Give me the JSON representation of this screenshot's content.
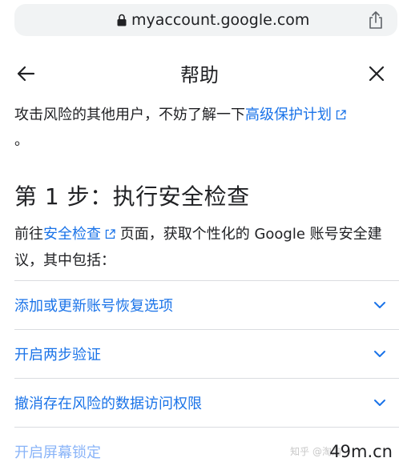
{
  "browser": {
    "url": "myaccount.google.com"
  },
  "header": {
    "title": "帮助"
  },
  "content": {
    "para1_text": "攻击风险的其他用户，不妨了解一下",
    "para1_link": "高级保护计划",
    "para1_end": "。",
    "heading": "第 1 步：执行安全检查",
    "para2_pre": "前往",
    "para2_link": "安全检查",
    "para2_post": "页面，获取个性化的 Google 账号安全建议，其中包括："
  },
  "list": {
    "items": [
      {
        "label": "添加或更新账号恢复选项"
      },
      {
        "label": "开启两步验证"
      },
      {
        "label": "撤消存在风险的数据访问权限"
      },
      {
        "label": "开启屏幕锁定"
      }
    ]
  },
  "watermark": {
    "text": "49m.cn",
    "faint": "知乎 @淘淘"
  },
  "colors": {
    "link": "#1a73e8",
    "text": "#202124",
    "divider": "#dadce0"
  }
}
